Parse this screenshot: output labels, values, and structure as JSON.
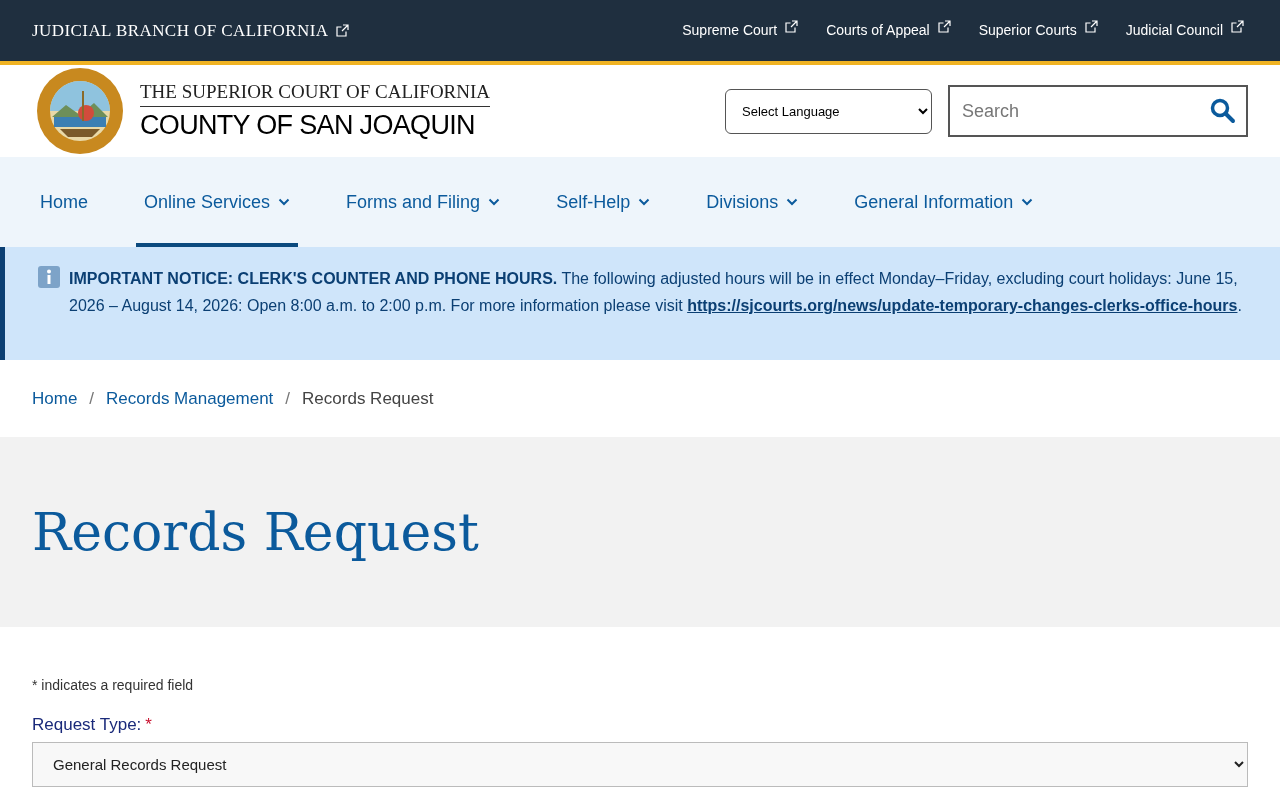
{
  "top_bar": {
    "brand": "JUDICIAL BRANCH OF CALIFORNIA",
    "links": [
      "Supreme Court",
      "Courts of Appeal",
      "Superior Courts",
      "Judicial Council"
    ]
  },
  "header": {
    "logo_line_1": "THE SUPERIOR COURT OF CALIFORNIA",
    "logo_line_2": "COUNTY OF SAN JOAQUIN",
    "language_select": "Select Language",
    "search": {
      "placeholder": "Search"
    }
  },
  "nav": [
    {
      "label": "Home",
      "has_dropdown": false,
      "selected": false
    },
    {
      "label": "Online Services",
      "has_dropdown": true,
      "selected": true
    },
    {
      "label": "Forms and Filing",
      "has_dropdown": true,
      "selected": false
    },
    {
      "label": "Self-Help",
      "has_dropdown": true,
      "selected": false
    },
    {
      "label": "Divisions",
      "has_dropdown": true,
      "selected": false
    },
    {
      "label": "General Information",
      "has_dropdown": true,
      "selected": false
    }
  ],
  "notice": {
    "text": "**IMPORTANT NOTICE: CLERK'S COUNTER AND PHONE HOURS.** The following adjusted hours will be in effect Monday–Friday, excluding court holidays: June 15, 2026 – August 14, 2026: Open 8:00 a.m. to 2:00 p.m. For more information please visit",
    "link": "https://sjcourts.org/news/update-temporary-changes-clerks-office-hours",
    "end": "."
  },
  "breadcrumb": [
    {
      "label": "Home",
      "separator": "/",
      "current": false
    },
    {
      "label": "Records Management",
      "separator": "/",
      "current": false
    },
    {
      "label": "Records Request",
      "current": true
    }
  ],
  "page_title": "Records Request",
  "form": {
    "required_note": "* indicates a required field",
    "fields": [
      {
        "label": "Request Type:",
        "required_mark": "*",
        "value": "General Records Request"
      }
    ]
  }
}
